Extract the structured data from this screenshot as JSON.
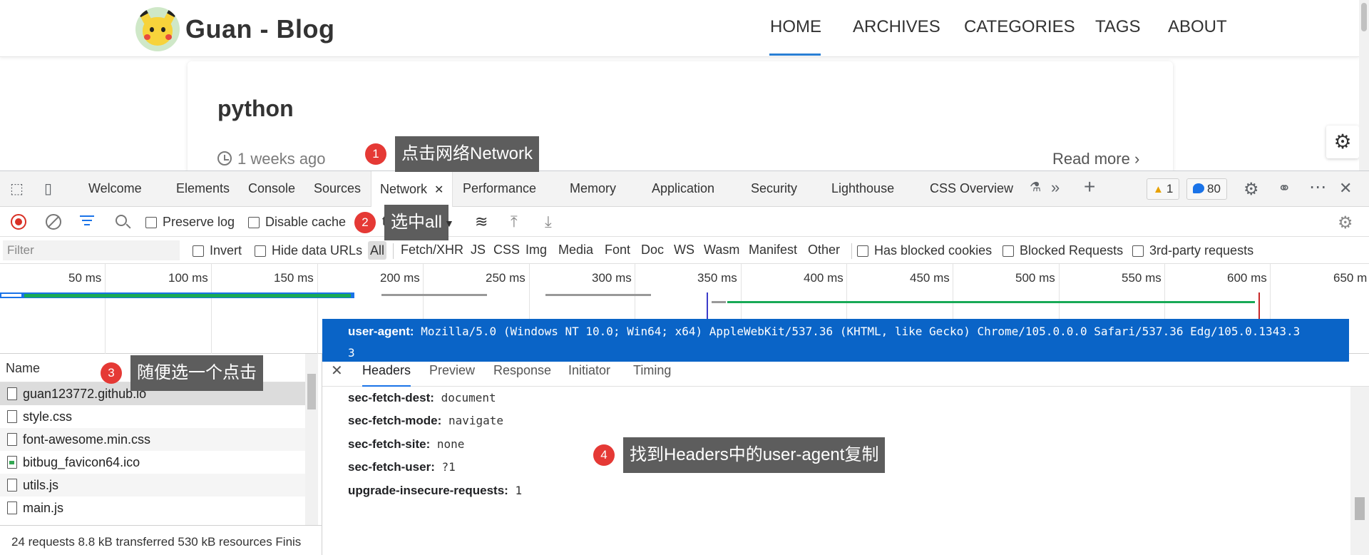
{
  "blog": {
    "title": "Guan - Blog",
    "nav": [
      "HOME",
      "ARCHIVES",
      "CATEGORIES",
      "TAGS",
      "ABOUT"
    ],
    "active_nav": "HOME",
    "post": {
      "title": "python",
      "time": "1 weeks ago",
      "read_more": "Read more ›"
    }
  },
  "devtools": {
    "tabs": [
      "Welcome",
      "Elements",
      "Console",
      "Sources",
      "Network",
      "Performance",
      "Memory",
      "Application",
      "Security",
      "Lighthouse",
      "CSS Overview"
    ],
    "active_tab": "Network",
    "warnings": "1",
    "messages": "80",
    "toolbar": {
      "preserve_log": "Preserve log",
      "disable_cache": "Disable cache",
      "throttle": "th"
    },
    "filter": {
      "placeholder": "Filter",
      "invert": "Invert",
      "hide_data_urls": "Hide data URLs",
      "types": [
        "All",
        "Fetch/XHR",
        "JS",
        "CSS",
        "Img",
        "Media",
        "Font",
        "Doc",
        "WS",
        "Wasm",
        "Manifest",
        "Other"
      ],
      "selected_type": "All",
      "has_blocked_cookies": "Has blocked cookies",
      "blocked_requests": "Blocked Requests",
      "third_party": "3rd-party requests"
    },
    "timeline_ticks": [
      "50 ms",
      "100 ms",
      "150 ms",
      "200 ms",
      "250 ms",
      "300 ms",
      "350 ms",
      "400 ms",
      "450 ms",
      "500 ms",
      "550 ms",
      "600 ms",
      "650 m"
    ],
    "requests_header": "Name",
    "requests": [
      "guan123772.github.io",
      "style.css",
      "font-awesome.min.css",
      "bitbug_favicon64.ico",
      "utils.js",
      "main.js"
    ],
    "status": "24 requests   8.8 kB transferred   530 kB resources   Finis",
    "detail_tabs": [
      "Headers",
      "Preview",
      "Response",
      "Initiator",
      "Timing"
    ],
    "active_detail_tab": "Headers",
    "headers": [
      {
        "name": "sec-fetch-dest:",
        "value": "document"
      },
      {
        "name": "sec-fetch-mode:",
        "value": "navigate"
      },
      {
        "name": "sec-fetch-site:",
        "value": "none"
      },
      {
        "name": "sec-fetch-user:",
        "value": "?1"
      },
      {
        "name": "upgrade-insecure-requests:",
        "value": "1"
      }
    ],
    "user_agent": {
      "name": "user-agent:",
      "value": "Mozilla/5.0 (Windows NT 10.0; Win64; x64) AppleWebKit/537.36 (KHTML, like Gecko) Chrome/105.0.0.0 Safari/537.36 Edg/105.0.1343.3",
      "value_cont": "3"
    }
  },
  "annotations": [
    {
      "num": "1",
      "text": "点击网络Network"
    },
    {
      "num": "2",
      "text": "选中all"
    },
    {
      "num": "3",
      "text": "随便选一个点击"
    },
    {
      "num": "4",
      "text": "找到Headers中的user-agent复制"
    }
  ],
  "colors": {
    "accent": "#1a73e8",
    "selected_row": "#0a64c7",
    "annotation_badge": "#e53935",
    "annotation_label": "#5d5d5d"
  }
}
